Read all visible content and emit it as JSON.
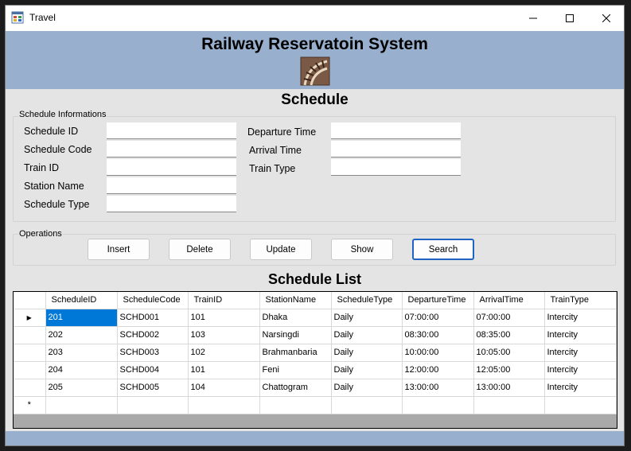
{
  "window": {
    "title": "Travel"
  },
  "header": {
    "app_title": "Railway Reservatoin System"
  },
  "schedule": {
    "title": "Schedule",
    "group_caption": "Schedule Informations",
    "fields_left": [
      {
        "label": "Schedule ID",
        "value": ""
      },
      {
        "label": "Schedule Code",
        "value": ""
      },
      {
        "label": "Train ID",
        "value": ""
      },
      {
        "label": "Station Name",
        "value": ""
      },
      {
        "label": "Schedule Type",
        "value": ""
      }
    ],
    "fields_right": [
      {
        "label": "Departure Time",
        "value": ""
      },
      {
        "label": "Arrival Time",
        "value": ""
      },
      {
        "label": "Train Type",
        "value": ""
      }
    ]
  },
  "operations": {
    "caption": "Operations",
    "buttons": [
      "Insert",
      "Delete",
      "Update",
      "Show",
      "Search"
    ]
  },
  "list": {
    "title": "Schedule List",
    "columns": [
      "ScheduleID",
      "ScheduleCode",
      "TrainID",
      "StationName",
      "ScheduleType",
      "DepartureTime",
      "ArrivalTime",
      "TrainType"
    ],
    "rows": [
      [
        "201",
        "SCHD001",
        "101",
        "Dhaka",
        "Daily",
        "07:00:00",
        "07:00:00",
        "Intercity"
      ],
      [
        "202",
        "SCHD002",
        "103",
        "Narsingdi",
        "Daily",
        "08:30:00",
        "08:35:00",
        "Intercity"
      ],
      [
        "203",
        "SCHD003",
        "102",
        "Brahmanbaria",
        "Daily",
        "10:00:00",
        "10:05:00",
        "Intercity"
      ],
      [
        "204",
        "SCHD004",
        "101",
        "Feni",
        "Daily",
        "12:00:00",
        "12:05:00",
        "Intercity"
      ],
      [
        "205",
        "SCHD005",
        "104",
        "Chattogram",
        "Daily",
        "13:00:00",
        "13:00:00",
        "Intercity"
      ]
    ],
    "current_row_marker": "▶",
    "new_row_marker": "*"
  },
  "colors": {
    "header_band": "#98b0ce",
    "selection": "#0078d7",
    "focus_border": "#1f64c2"
  },
  "icons": {
    "app": "app-window-icon",
    "logo": "railway-track-icon",
    "minimize": "minimize-icon",
    "maximize": "maximize-icon",
    "close": "close-icon"
  }
}
